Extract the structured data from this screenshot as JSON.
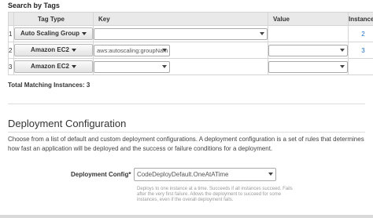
{
  "search": {
    "title": "Search by Tags",
    "headers": {
      "num": "",
      "tag_type": "Tag Type",
      "key": "Key",
      "value": "Value",
      "instances": "Instances"
    },
    "rows": [
      {
        "num": "1",
        "tag_type": "Auto Scaling Group",
        "key": "",
        "value": "",
        "instances": "2"
      },
      {
        "num": "2",
        "tag_type": "Amazon EC2",
        "key": "aws:autoscaling:groupNam",
        "value": "",
        "instances": "3"
      },
      {
        "num": "3",
        "tag_type": "Amazon EC2",
        "key": "",
        "value": "",
        "instances": ""
      }
    ],
    "total": "Total Matching Instances: 3"
  },
  "deployment": {
    "title": "Deployment Configuration",
    "description": "Choose from a list of default and custom deployment configurations. A deployment configuration is a set of rules that determines how fast an application will be deployed and the success or failure conditions for a deployment.",
    "config_label": "Deployment Config*",
    "config_value": "CodeDeployDefault.OneAtATime",
    "config_help": "Deploys to one instance at a time. Succeeds if all instances succeed. Fails after the very first failure. Allows the deployment to succeed for some instances, even if the overall deployment fails."
  },
  "colors": {
    "link": "#1a6fc9",
    "header_bg": "#e9e9e9",
    "border": "#d5d5d5"
  }
}
